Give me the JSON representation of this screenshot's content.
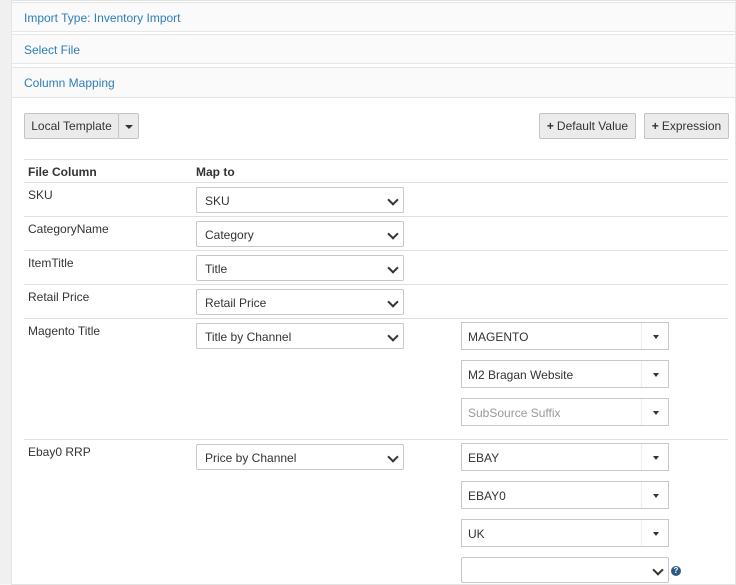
{
  "sections": {
    "import_type": "Import Type: Inventory Import",
    "select_file": "Select File",
    "column_mapping": "Column Mapping"
  },
  "toolbar": {
    "local_template": "Local Template",
    "default_value": "Default Value",
    "expression": "Expression"
  },
  "table": {
    "col_file": "File Column",
    "col_map": "Map to"
  },
  "rows": [
    {
      "file_column": "SKU",
      "map_to": "SKU"
    },
    {
      "file_column": "CategoryName",
      "map_to": "Category"
    },
    {
      "file_column": "ItemTitle",
      "map_to": "Title"
    },
    {
      "file_column": "Retail Price",
      "map_to": "Retail Price"
    },
    {
      "file_column": "Magento Title",
      "map_to": "Title by Channel",
      "channel": "MAGENTO",
      "subsource": "M2 Bragan Website",
      "suffix_placeholder": "SubSource Suffix"
    },
    {
      "file_column": "Ebay0 RRP",
      "map_to": "Price by Channel",
      "channel": "EBAY",
      "subsource": "EBAY0",
      "region": "UK",
      "extra": ""
    }
  ],
  "icons": {
    "help": "?"
  },
  "colors": {
    "link": "#2e7dba",
    "help_icon": "#2b5a85"
  }
}
